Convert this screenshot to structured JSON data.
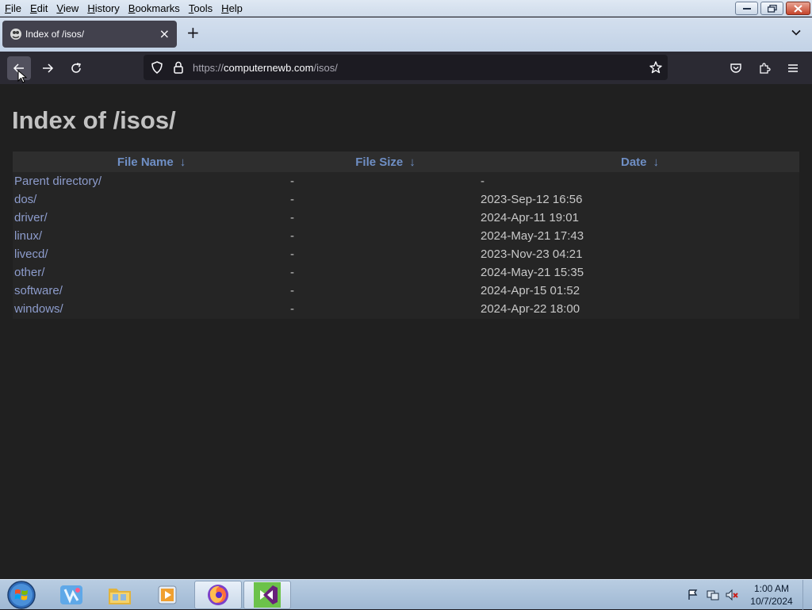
{
  "menubar": {
    "items": [
      "File",
      "Edit",
      "View",
      "History",
      "Bookmarks",
      "Tools",
      "Help"
    ]
  },
  "tab": {
    "title": "Index of /isos/",
    "close_glyph": "×"
  },
  "new_tab_glyph": "+",
  "navbar": {
    "url_scheme": "https://",
    "url_host": "computernewb.com",
    "url_path": "/isos/"
  },
  "page": {
    "heading": "Index of /isos/",
    "columns": [
      {
        "label": "File Name",
        "arrow": "↓"
      },
      {
        "label": "File Size",
        "arrow": "↓"
      },
      {
        "label": "Date",
        "arrow": "↓"
      }
    ],
    "rows": [
      {
        "name": "Parent directory/",
        "size": "-",
        "date": "-"
      },
      {
        "name": "dos/",
        "size": "-",
        "date": "2023-Sep-12 16:56"
      },
      {
        "name": "driver/",
        "size": "-",
        "date": "2024-Apr-11 19:01"
      },
      {
        "name": "linux/",
        "size": "-",
        "date": "2024-May-21 17:43"
      },
      {
        "name": "livecd/",
        "size": "-",
        "date": "2023-Nov-23 04:21"
      },
      {
        "name": "other/",
        "size": "-",
        "date": "2024-May-21 15:35"
      },
      {
        "name": "software/",
        "size": "-",
        "date": "2024-Apr-15 01:52"
      },
      {
        "name": "windows/",
        "size": "-",
        "date": "2024-Apr-22 18:00"
      }
    ]
  },
  "taskbar": {
    "time": "1:00 AM",
    "date": "10/7/2024"
  },
  "colors": {
    "page_bg": "#202020",
    "link": "#8d9ccc",
    "header_link": "#6f8fc5",
    "heading": "#c2c2c2"
  }
}
